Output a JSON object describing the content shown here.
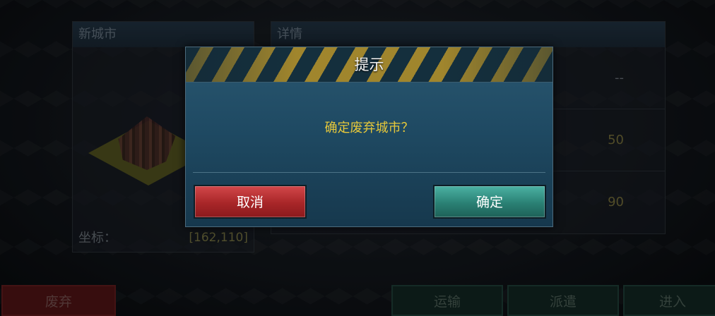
{
  "left_panel": {
    "title": "新城市",
    "coord_label": "坐标：",
    "coord_value": "[162,110]"
  },
  "right_panel": {
    "title": "详情",
    "values": [
      "--",
      "50",
      "90"
    ]
  },
  "bottom_bar": {
    "abandon_label": "废弃",
    "transport_label": "运输",
    "dispatch_label": "派遣",
    "enter_label": "进入"
  },
  "dialog": {
    "title": "提示",
    "message": "确定废弃城市？",
    "cancel_label": "取消",
    "confirm_label": "确定"
  },
  "colors": {
    "cancel": "#b8302f",
    "confirm": "#2f8a7d",
    "message": "#e7c83a"
  }
}
